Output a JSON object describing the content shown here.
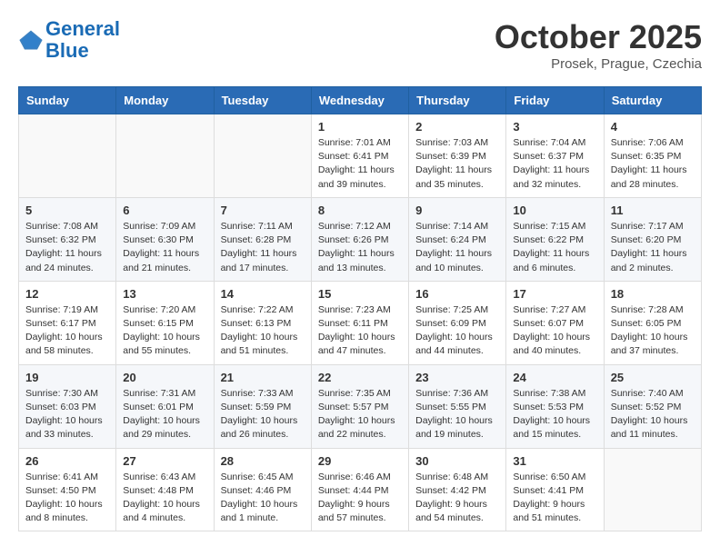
{
  "logo": {
    "text_general": "General",
    "text_blue": "Blue"
  },
  "title": "October 2025",
  "location": "Prosek, Prague, Czechia",
  "weekdays": [
    "Sunday",
    "Monday",
    "Tuesday",
    "Wednesday",
    "Thursday",
    "Friday",
    "Saturday"
  ],
  "weeks": [
    [
      {
        "day": "",
        "info": ""
      },
      {
        "day": "",
        "info": ""
      },
      {
        "day": "",
        "info": ""
      },
      {
        "day": "1",
        "info": "Sunrise: 7:01 AM\nSunset: 6:41 PM\nDaylight: 11 hours\nand 39 minutes."
      },
      {
        "day": "2",
        "info": "Sunrise: 7:03 AM\nSunset: 6:39 PM\nDaylight: 11 hours\nand 35 minutes."
      },
      {
        "day": "3",
        "info": "Sunrise: 7:04 AM\nSunset: 6:37 PM\nDaylight: 11 hours\nand 32 minutes."
      },
      {
        "day": "4",
        "info": "Sunrise: 7:06 AM\nSunset: 6:35 PM\nDaylight: 11 hours\nand 28 minutes."
      }
    ],
    [
      {
        "day": "5",
        "info": "Sunrise: 7:08 AM\nSunset: 6:32 PM\nDaylight: 11 hours\nand 24 minutes."
      },
      {
        "day": "6",
        "info": "Sunrise: 7:09 AM\nSunset: 6:30 PM\nDaylight: 11 hours\nand 21 minutes."
      },
      {
        "day": "7",
        "info": "Sunrise: 7:11 AM\nSunset: 6:28 PM\nDaylight: 11 hours\nand 17 minutes."
      },
      {
        "day": "8",
        "info": "Sunrise: 7:12 AM\nSunset: 6:26 PM\nDaylight: 11 hours\nand 13 minutes."
      },
      {
        "day": "9",
        "info": "Sunrise: 7:14 AM\nSunset: 6:24 PM\nDaylight: 11 hours\nand 10 minutes."
      },
      {
        "day": "10",
        "info": "Sunrise: 7:15 AM\nSunset: 6:22 PM\nDaylight: 11 hours\nand 6 minutes."
      },
      {
        "day": "11",
        "info": "Sunrise: 7:17 AM\nSunset: 6:20 PM\nDaylight: 11 hours\nand 2 minutes."
      }
    ],
    [
      {
        "day": "12",
        "info": "Sunrise: 7:19 AM\nSunset: 6:17 PM\nDaylight: 10 hours\nand 58 minutes."
      },
      {
        "day": "13",
        "info": "Sunrise: 7:20 AM\nSunset: 6:15 PM\nDaylight: 10 hours\nand 55 minutes."
      },
      {
        "day": "14",
        "info": "Sunrise: 7:22 AM\nSunset: 6:13 PM\nDaylight: 10 hours\nand 51 minutes."
      },
      {
        "day": "15",
        "info": "Sunrise: 7:23 AM\nSunset: 6:11 PM\nDaylight: 10 hours\nand 47 minutes."
      },
      {
        "day": "16",
        "info": "Sunrise: 7:25 AM\nSunset: 6:09 PM\nDaylight: 10 hours\nand 44 minutes."
      },
      {
        "day": "17",
        "info": "Sunrise: 7:27 AM\nSunset: 6:07 PM\nDaylight: 10 hours\nand 40 minutes."
      },
      {
        "day": "18",
        "info": "Sunrise: 7:28 AM\nSunset: 6:05 PM\nDaylight: 10 hours\nand 37 minutes."
      }
    ],
    [
      {
        "day": "19",
        "info": "Sunrise: 7:30 AM\nSunset: 6:03 PM\nDaylight: 10 hours\nand 33 minutes."
      },
      {
        "day": "20",
        "info": "Sunrise: 7:31 AM\nSunset: 6:01 PM\nDaylight: 10 hours\nand 29 minutes."
      },
      {
        "day": "21",
        "info": "Sunrise: 7:33 AM\nSunset: 5:59 PM\nDaylight: 10 hours\nand 26 minutes."
      },
      {
        "day": "22",
        "info": "Sunrise: 7:35 AM\nSunset: 5:57 PM\nDaylight: 10 hours\nand 22 minutes."
      },
      {
        "day": "23",
        "info": "Sunrise: 7:36 AM\nSunset: 5:55 PM\nDaylight: 10 hours\nand 19 minutes."
      },
      {
        "day": "24",
        "info": "Sunrise: 7:38 AM\nSunset: 5:53 PM\nDaylight: 10 hours\nand 15 minutes."
      },
      {
        "day": "25",
        "info": "Sunrise: 7:40 AM\nSunset: 5:52 PM\nDaylight: 10 hours\nand 11 minutes."
      }
    ],
    [
      {
        "day": "26",
        "info": "Sunrise: 6:41 AM\nSunset: 4:50 PM\nDaylight: 10 hours\nand 8 minutes."
      },
      {
        "day": "27",
        "info": "Sunrise: 6:43 AM\nSunset: 4:48 PM\nDaylight: 10 hours\nand 4 minutes."
      },
      {
        "day": "28",
        "info": "Sunrise: 6:45 AM\nSunset: 4:46 PM\nDaylight: 10 hours\nand 1 minute."
      },
      {
        "day": "29",
        "info": "Sunrise: 6:46 AM\nSunset: 4:44 PM\nDaylight: 9 hours\nand 57 minutes."
      },
      {
        "day": "30",
        "info": "Sunrise: 6:48 AM\nSunset: 4:42 PM\nDaylight: 9 hours\nand 54 minutes."
      },
      {
        "day": "31",
        "info": "Sunrise: 6:50 AM\nSunset: 4:41 PM\nDaylight: 9 hours\nand 51 minutes."
      },
      {
        "day": "",
        "info": ""
      }
    ]
  ]
}
